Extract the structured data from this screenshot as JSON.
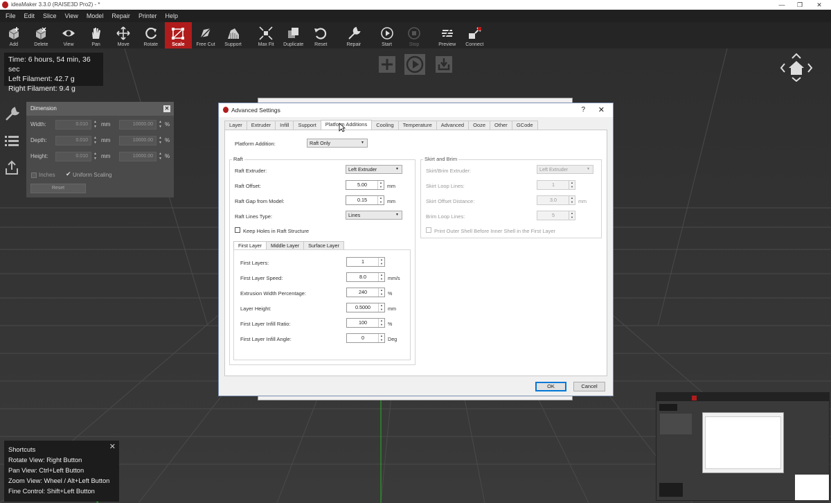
{
  "window": {
    "title": "ideaMaker 3.3.0 (RAISE3D Pro2) - *"
  },
  "menu": [
    "File",
    "Edit",
    "Slice",
    "View",
    "Model",
    "Repair",
    "Printer",
    "Help"
  ],
  "toolbar": [
    {
      "label": "Add",
      "icon": "add-cube-icon"
    },
    {
      "label": "Delete",
      "icon": "delete-cube-icon"
    },
    {
      "label": "View",
      "icon": "eye-icon"
    },
    {
      "label": "Pan",
      "icon": "hand-icon"
    },
    {
      "label": "Move",
      "icon": "move-arrows-icon"
    },
    {
      "label": "Rotate",
      "icon": "rotate-icon"
    },
    {
      "label": "Scale",
      "icon": "scale-icon"
    },
    {
      "label": "Free Cut",
      "icon": "free-cut-icon"
    },
    {
      "label": "Support",
      "icon": "support-icon"
    },
    {
      "label": "Max Fit",
      "icon": "max-fit-icon"
    },
    {
      "label": "Duplicate",
      "icon": "duplicate-icon"
    },
    {
      "label": "Reset",
      "icon": "reset-icon"
    },
    {
      "label": "Repair",
      "icon": "wrench-icon"
    },
    {
      "label": "Start",
      "icon": "play-icon"
    },
    {
      "label": "Stop",
      "icon": "stop-icon"
    },
    {
      "label": "Preview",
      "icon": "preview-layers-icon"
    },
    {
      "label": "Connect",
      "icon": "connect-icon"
    }
  ],
  "info": {
    "time": "Time: 6 hours, 54 min, 36 sec",
    "left_filament": "Left Filament: 42.7 g",
    "right_filament": "Right Filament: 9.4 g"
  },
  "dimension_panel": {
    "title": "Dimension",
    "rows": [
      {
        "label": "Width:",
        "value": "0.010",
        "unit": "mm",
        "percent": "10000.00",
        "pct_unit": "%"
      },
      {
        "label": "Depth:",
        "value": "0.010",
        "unit": "mm",
        "percent": "10000.00",
        "pct_unit": "%"
      },
      {
        "label": "Height:",
        "value": "0.010",
        "unit": "mm",
        "percent": "10000.00",
        "pct_unit": "%"
      }
    ],
    "inches_label": "Inches",
    "uniform_label": "Uniform Scaling",
    "reset_label": "Reset"
  },
  "dialog": {
    "title": "Advanced Settings",
    "help": "?",
    "close": "✕",
    "tabs": [
      "Layer",
      "Extruder",
      "Infill",
      "Support",
      "Platform Additions",
      "Cooling",
      "Temperature",
      "Advanced",
      "Ooze",
      "Other",
      "GCode"
    ],
    "platform_addition_label": "Platform Addition:",
    "platform_addition_value": "Raft Only",
    "raft": {
      "title": "Raft",
      "extruder_label": "Raft Extruder:",
      "extruder_value": "Left Extruder",
      "offset_label": "Raft Offset:",
      "offset_value": "5.00",
      "offset_unit": "mm",
      "gap_label": "Raft Gap from Model:",
      "gap_value": "0.15",
      "gap_unit": "mm",
      "lines_type_label": "Raft Lines Type:",
      "lines_type_value": "Lines",
      "keep_holes_label": "Keep Holes in Raft Structure"
    },
    "layer_tabs": [
      "First Layer",
      "Middle Layer",
      "Surface Layer"
    ],
    "first_layer": {
      "layers_label": "First Layers:",
      "layers_value": "1",
      "speed_label": "First Layer Speed:",
      "speed_value": "8.0",
      "speed_unit": "mm/s",
      "extrusion_label": "Extrusion Width Percentage:",
      "extrusion_value": "240",
      "extrusion_unit": "%",
      "height_label": "Layer Height:",
      "height_value": "0.5000",
      "height_unit": "mm",
      "infill_ratio_label": "First Layer Infill Ratio:",
      "infill_ratio_value": "100",
      "infill_ratio_unit": "%",
      "infill_angle_label": "First Layer Infill Angle:",
      "infill_angle_value": "0",
      "infill_angle_unit": "Deg"
    },
    "skirt": {
      "title": "Skirt and Brim",
      "extruder_label": "Skirt/Brim Extruder:",
      "extruder_value": "Left Extruder",
      "loop_label": "Skirt Loop Lines:",
      "loop_value": "1",
      "offset_label": "Skirt Offset Distance:",
      "offset_value": "3.0",
      "offset_unit": "mm",
      "brim_label": "Brim Loop Lines:",
      "brim_value": "5",
      "print_outer_label": "Print Outer Shell Before Inner Shell in the First Layer"
    },
    "ok_label": "OK",
    "cancel_label": "Cancel"
  },
  "shortcuts": {
    "title": "Shortcuts",
    "items": [
      "Rotate View: Right Button",
      "Pan View: Ctrl+Left Button",
      "Zoom View: Wheel / Alt+Left Button",
      "Fine Control: Shift+Left Button"
    ],
    "close": "✕"
  },
  "colors": {
    "accent": "#b01c1c",
    "background": "#2b2b2b",
    "toolbar": "#252525"
  }
}
